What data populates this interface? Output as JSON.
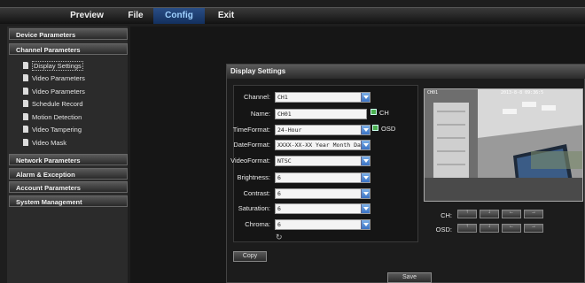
{
  "top_menu": [
    "Preview",
    "File",
    "Config",
    "Exit"
  ],
  "sidebar": {
    "device_parameters": "Device Parameters",
    "channel_parameters": "Channel Parameters",
    "channel_items": [
      "Display Settings",
      "Video Parameters",
      "Video Parameters",
      "Schedule Record",
      "Motion Detection",
      "Video Tampering",
      "Video Mask"
    ],
    "network_parameters": "Network Parameters",
    "alarm_exception": "Alarm & Exception",
    "account_parameters": "Account Parameters",
    "system_management": "System Management"
  },
  "panel": {
    "title": "Display Settings",
    "form": {
      "channel_label": "Channel:",
      "channel_value": "CH1",
      "name_label": "Name:",
      "name_value": "CH01",
      "ch_check_label": "CH",
      "timeformat_label": "TimeFormat:",
      "timeformat_value": "24-Hour",
      "osd_check_label": "OSD",
      "dateformat_label": "DateFormat:",
      "dateformat_value": "XXXX-XX-XX Year Month Day",
      "videoformat_label": "VideoFormat:",
      "videoformat_value": "NTSC",
      "brightness_label": "Brightness:",
      "brightness_value": "6",
      "contrast_label": "Contrast:",
      "contrast_value": "6",
      "saturation_label": "Saturation:",
      "saturation_value": "6",
      "chroma_label": "Chroma:",
      "chroma_value": "6"
    },
    "preview": {
      "osd_channel": "CH01",
      "osd_datetime": "2013-8-8 09:36:5"
    },
    "ch_nav_label": "CH:",
    "osd_nav_label": "OSD:",
    "nav_buttons": [
      "↑",
      "↓",
      "←",
      "→"
    ],
    "copy_label": "Copy",
    "save_label": "Save"
  },
  "colors": {
    "accent_blue": "#2a4e86",
    "checkbox_green": "#4caf50"
  }
}
